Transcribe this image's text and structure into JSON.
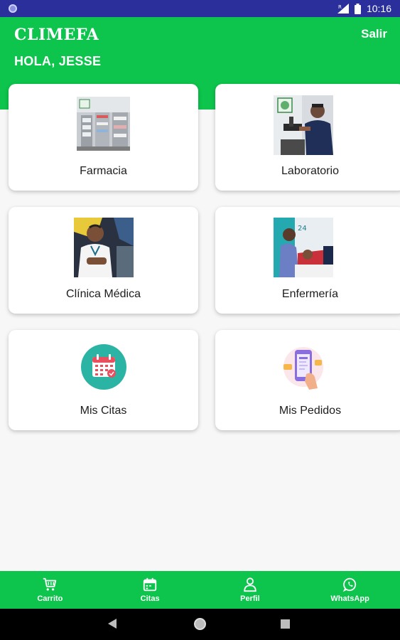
{
  "status_bar": {
    "time": "10:16"
  },
  "header": {
    "app_title": "CLIMEFA",
    "logout_label": "Salir",
    "greeting": "HOLA, JESSE"
  },
  "cards": [
    {
      "label": "Farmacia",
      "icon": "pharmacy-photo"
    },
    {
      "label": "Laboratorio",
      "icon": "laboratory-photo"
    },
    {
      "label": "Clínica Médica",
      "icon": "doctor-photo"
    },
    {
      "label": "Enfermería",
      "icon": "nurse-photo"
    },
    {
      "label": "Mis Citas",
      "icon": "calendar-icon"
    },
    {
      "label": "Mis Pedidos",
      "icon": "phone-order-icon"
    }
  ],
  "bottom_nav": [
    {
      "label": "Carrito",
      "icon": "cart-icon"
    },
    {
      "label": "Citas",
      "icon": "calendar-icon"
    },
    {
      "label": "Perfil",
      "icon": "person-icon"
    },
    {
      "label": "WhatsApp",
      "icon": "whatsapp-icon"
    }
  ],
  "colors": {
    "brand_green": "#0dc44c",
    "status_bar": "#2a2f9c",
    "calendar_teal": "#2bb3a3"
  }
}
